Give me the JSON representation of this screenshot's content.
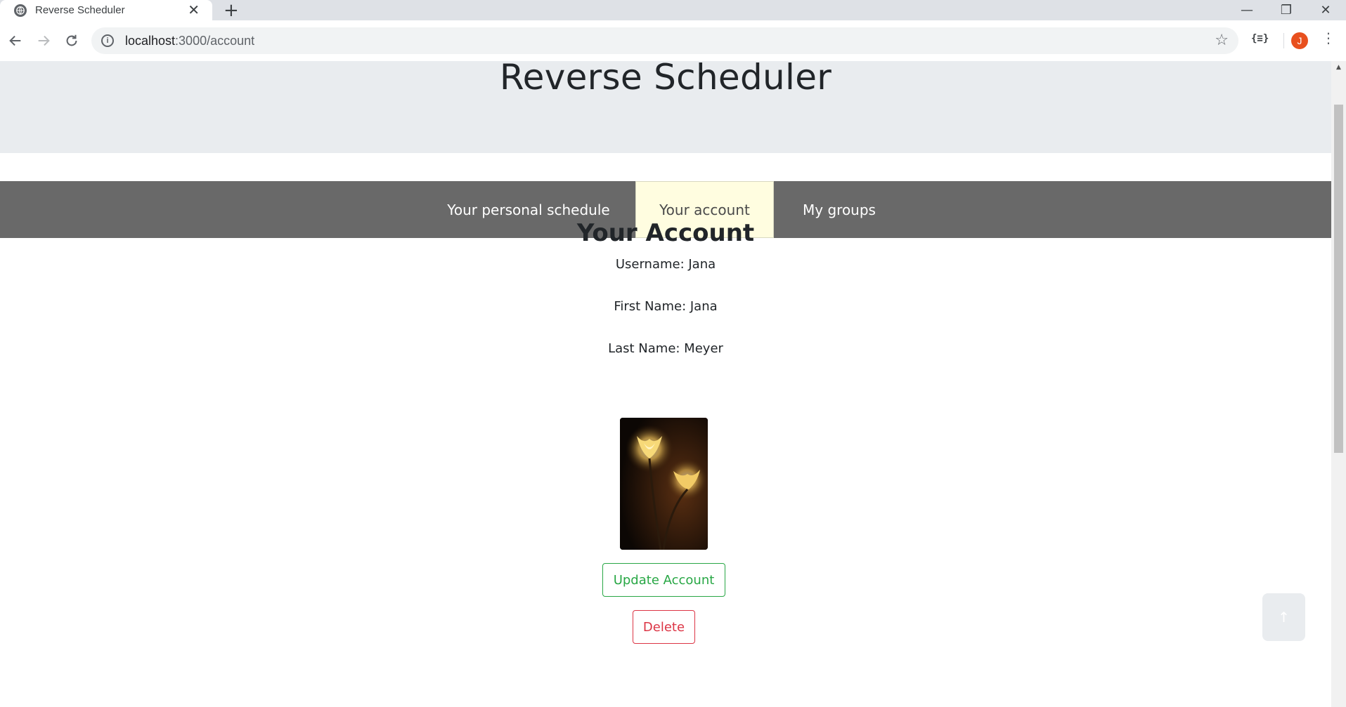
{
  "browser": {
    "tab_title": "Reverse Scheduler",
    "tab_close": "✕",
    "new_tab": "+",
    "url_host": "localhost",
    "url_path": ":3000/account",
    "profile_initial": "J",
    "extension_label": "{≡}",
    "window_controls": {
      "minimize": "—",
      "maximize": "❐",
      "close": "✕"
    }
  },
  "header": {
    "title": "Reverse Scheduler"
  },
  "nav": {
    "items": [
      {
        "label": "Your personal schedule",
        "active": false
      },
      {
        "label": "Your account",
        "active": true
      },
      {
        "label": "My groups",
        "active": false
      }
    ]
  },
  "account": {
    "heading": "Your Account",
    "username": "Username: Jana",
    "first_name": "First Name: Jana",
    "last_name": "Last Name: Meyer"
  },
  "actions": {
    "update_label": "Update Account",
    "delete_label": "Delete",
    "back_to_top": "↑"
  },
  "colors": {
    "accent_success": "#28a745",
    "accent_danger": "#dc3545",
    "nav_background": "#696969",
    "nav_active_background": "#fffde0",
    "jumbotron": "#e9ecef"
  }
}
